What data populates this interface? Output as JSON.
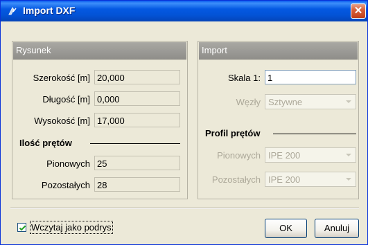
{
  "window": {
    "title": "Import DXF",
    "close_glyph": "✕"
  },
  "rysunek": {
    "header": "Rysunek",
    "fields": [
      {
        "label": "Szerokość [m]",
        "value": "20,000"
      },
      {
        "label": "Długość [m]",
        "value": "0,000"
      },
      {
        "label": "Wysokość [m]",
        "value": "17,000"
      }
    ],
    "section": "Ilość prętów",
    "counts": [
      {
        "label": "Pionowych",
        "value": "25"
      },
      {
        "label": "Pozostałych",
        "value": "28"
      }
    ]
  },
  "import": {
    "header": "Import",
    "scale_label": "Skala 1:",
    "scale_value": "1",
    "nodes_label": "Węzły",
    "nodes_value": "Sztywne",
    "section": "Profil prętów",
    "profiles": [
      {
        "label": "Pionowych",
        "value": "IPE 200"
      },
      {
        "label": "Pozostałych",
        "value": "IPE 200"
      }
    ]
  },
  "footer": {
    "checkbox_label": "Wczytaj jako podrys",
    "checkbox_checked": true,
    "ok_label": "OK",
    "cancel_label": "Anuluj"
  }
}
